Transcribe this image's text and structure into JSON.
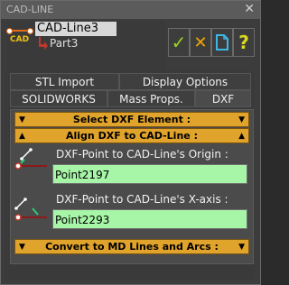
{
  "window": {
    "title": "CAD-LINE",
    "close_glyph": "✕"
  },
  "tree": {
    "icon_label": "CAD",
    "selected": "CAD-Line3",
    "child": "Part3"
  },
  "toolbar": {
    "ok_icon": "checkmark-icon",
    "cancel_icon": "x-icon",
    "new_icon": "document-icon",
    "help_icon": "question-icon",
    "ok_glyph": "✓",
    "cancel_glyph": "✕",
    "help_glyph": "?",
    "colors": {
      "ok": "#9ad61d",
      "cancel": "#f0a500",
      "new": "#3fb7e6",
      "help": "#d9d91e"
    }
  },
  "tabs": {
    "row1": [
      "STL Import",
      "Display Options"
    ],
    "row2": [
      "SOLIDWORKS",
      "Mass Props.",
      "DXF"
    ],
    "active": "DXF"
  },
  "sections": {
    "select_dxf": "Select DXF Element :",
    "align_dxf": "Align DXF to CAD-Line :",
    "convert": "Convert to MD Lines and Arcs :"
  },
  "origin": {
    "label": "DXF-Point to CAD-Line's Origin :",
    "value": "Point2197"
  },
  "xaxis": {
    "label": "DXF-Point to CAD-Line's X-axis :",
    "value": "Point2293"
  },
  "colors": {
    "section_bar": "#e0a32c",
    "field_bg": "#a7f5a7",
    "accent": "#e26a17"
  }
}
